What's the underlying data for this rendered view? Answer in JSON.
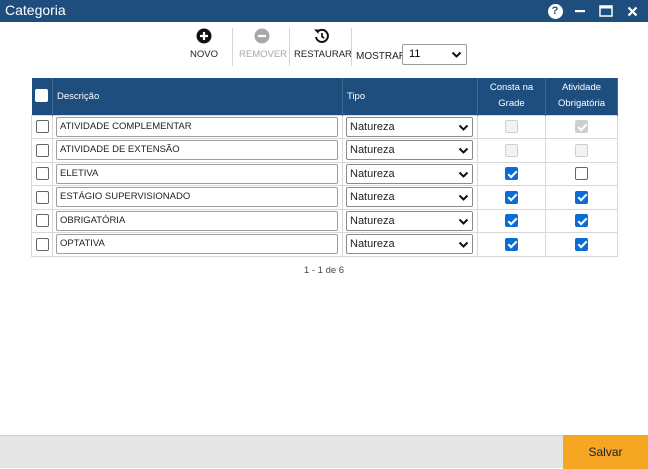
{
  "window": {
    "title": "Categoria",
    "help_label": "?"
  },
  "toolbar": {
    "novo_label": "NOVO",
    "remover_label": "REMOVER",
    "restaurar_label": "RESTAURAR",
    "mostrar_label": "MOSTRAR:",
    "mostrar_value": "11"
  },
  "table": {
    "headers": {
      "descricao": "Descrição",
      "tipo": "Tipo",
      "consta_line1": "Consta na",
      "consta_line2": "Grade",
      "atividade_line1": "Atividade",
      "atividade_line2": "Obrigatória"
    },
    "rows": [
      {
        "descricao": "ATIVIDADE COMPLEMENTAR",
        "tipo": "Natureza",
        "consta_grade": false,
        "consta_disabled": true,
        "obrigatoria": true,
        "obrigatoria_disabled": true
      },
      {
        "descricao": "ATIVIDADE DE EXTENSÃO",
        "tipo": "Natureza",
        "consta_grade": false,
        "consta_disabled": true,
        "obrigatoria": false,
        "obrigatoria_disabled": true
      },
      {
        "descricao": "ELETIVA",
        "tipo": "Natureza",
        "consta_grade": true,
        "consta_disabled": false,
        "obrigatoria": false,
        "obrigatoria_disabled": false
      },
      {
        "descricao": "ESTÁGIO SUPERVISIONADO",
        "tipo": "Natureza",
        "consta_grade": true,
        "consta_disabled": false,
        "obrigatoria": true,
        "obrigatoria_disabled": false
      },
      {
        "descricao": "OBRIGATÓRIA",
        "tipo": "Natureza",
        "consta_grade": true,
        "consta_disabled": false,
        "obrigatoria": true,
        "obrigatoria_disabled": false
      },
      {
        "descricao": "OPTATIVA",
        "tipo": "Natureza",
        "consta_grade": true,
        "consta_disabled": false,
        "obrigatoria": true,
        "obrigatoria_disabled": false
      }
    ]
  },
  "pager": {
    "text": "1 - 1 de 6"
  },
  "footer": {
    "save_label": "Salvar"
  },
  "colors": {
    "title_bar": "#1e4e7e",
    "header": "#1e4e7e",
    "checkbox_checked": "#0b6cd6",
    "save_button": "#f5a623"
  },
  "icons": {
    "novo": "plus-circle-icon",
    "remover": "minus-circle-icon",
    "restaurar": "restore-icon"
  }
}
